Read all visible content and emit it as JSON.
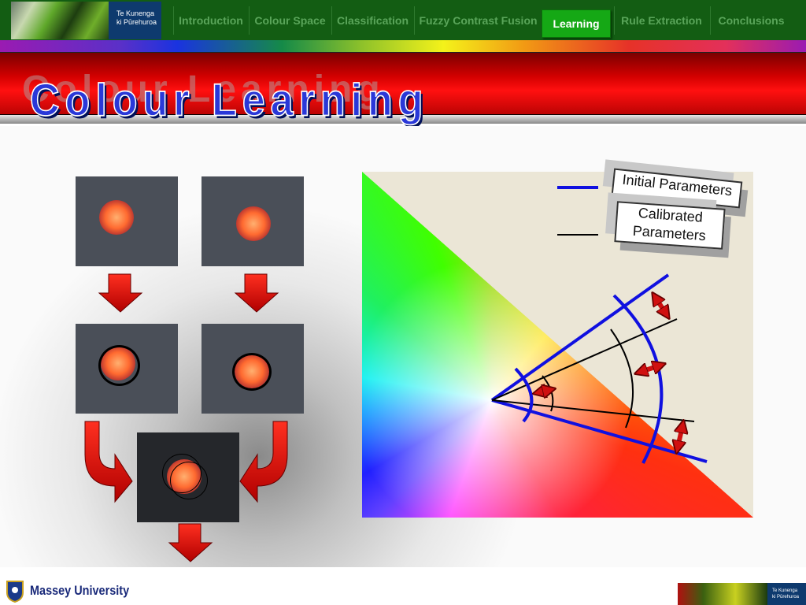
{
  "header": {
    "logo_text_line1": "Te Kunenga",
    "logo_text_line2": "ki Pūrehuroa"
  },
  "nav": [
    {
      "label": "Introduction"
    },
    {
      "label": "Colour Space"
    },
    {
      "label": "Classification"
    },
    {
      "label": "Fuzzy Contrast Fusion"
    },
    {
      "label": "Learning",
      "active": true
    },
    {
      "label": "Rule Extraction"
    },
    {
      "label": "Conclusions"
    }
  ],
  "slide": {
    "title": "Colour Learning"
  },
  "legend": {
    "initial": "Initial Parameters",
    "calibrated_line1": "Calibrated",
    "calibrated_line2": "Parameters",
    "initial_color": "#1010e0",
    "calibrated_color": "#000000"
  },
  "footer": {
    "university": "Massey University",
    "logo_text_line1": "Te Kunenga",
    "logo_text_line2": "ki Pūrehuroa"
  }
}
